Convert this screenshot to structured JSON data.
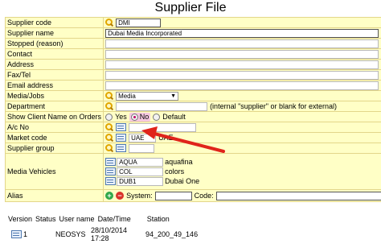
{
  "page": {
    "title": "Supplier File"
  },
  "form": {
    "supplier_code": {
      "label": "Supplier code",
      "value": "DMI"
    },
    "supplier_name": {
      "label": "Supplier name",
      "value": "Dubai Media Incorporated"
    },
    "stopped": {
      "label": "Stopped (reason)",
      "value": ""
    },
    "contact": {
      "label": "Contact",
      "value": ""
    },
    "address": {
      "label": "Address",
      "value": ""
    },
    "fax_tel": {
      "label": "Fax/Tel",
      "value": ""
    },
    "email": {
      "label": "Email address",
      "value": ""
    },
    "media_jobs": {
      "label": "Media/Jobs",
      "value": "Media",
      "arrow": "▼"
    },
    "department": {
      "label": "Department",
      "value": "",
      "hint": "(internal \"supplier\" or blank for external)"
    },
    "show_client": {
      "label": "Show Client Name on Orders",
      "opt_yes": "Yes",
      "opt_no": "No",
      "opt_default": "Default",
      "selected": "No"
    },
    "ac_no": {
      "label": "A/c No",
      "value": ""
    },
    "market_code": {
      "label": "Market code",
      "value": "UAE",
      "desc": "UAE"
    },
    "supplier_group": {
      "label": "Supplier group",
      "value": ""
    },
    "media_vehicles": {
      "label": "Media Vehicles",
      "items": [
        {
          "code": "AQUA",
          "name": "aquafina"
        },
        {
          "code": "COL",
          "name": "colors"
        },
        {
          "code": "DUB1",
          "name": "Dubai One"
        }
      ]
    },
    "alias": {
      "label": "Alias",
      "plus": "+",
      "minus": "−",
      "system_label": "System:",
      "code_label": "Code:",
      "system_value": "",
      "code_value": ""
    }
  },
  "footer": {
    "headers": [
      "Version",
      "Status",
      "User name",
      "Date/Time",
      "Station"
    ],
    "row": {
      "version": "1",
      "status": "",
      "user": "NEOSYS",
      "datetime": "28/10/2014 17:28",
      "station": "94_200_49_146"
    }
  },
  "colors": {
    "form_bg": "#ffffc6",
    "arrow": "#e0241b",
    "selected_option": "#f6c8e0"
  }
}
